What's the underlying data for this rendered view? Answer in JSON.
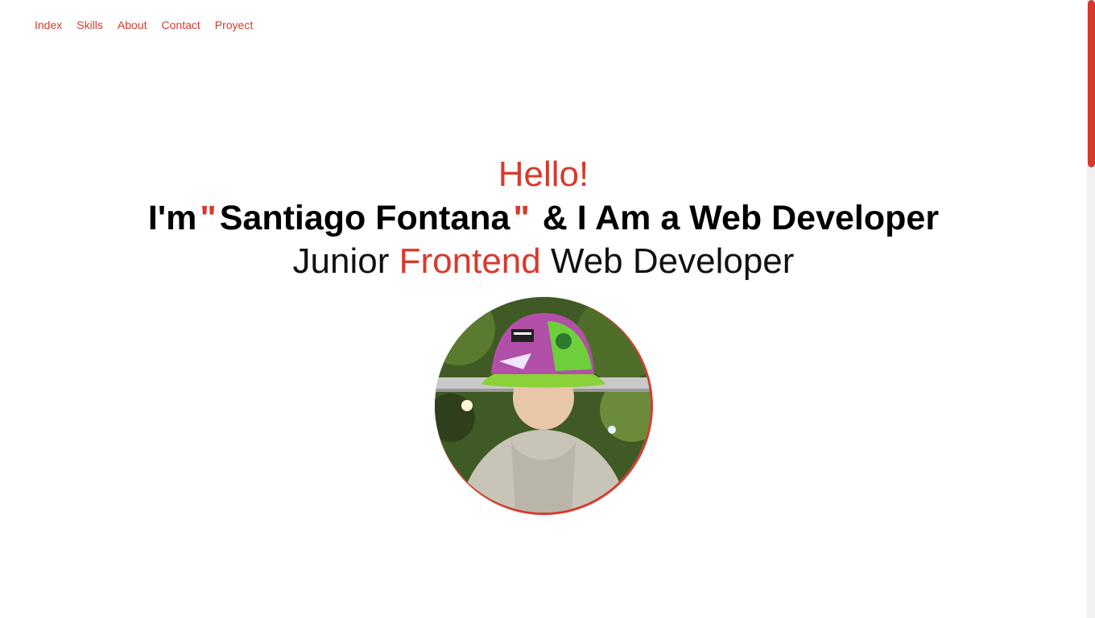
{
  "nav": {
    "items": [
      {
        "label": "Index"
      },
      {
        "label": "Skills"
      },
      {
        "label": "About"
      },
      {
        "label": "Contact"
      },
      {
        "label": "Proyect"
      }
    ]
  },
  "hero": {
    "greeting": "Hello!",
    "headline": {
      "prefix": "I'm",
      "open_quote": "\"",
      "name": "Santiago Fontana",
      "close_quote": "\"",
      "suffix": "& I Am a Web Developer"
    },
    "subline": {
      "part1": "Junior",
      "highlight": "Frontend",
      "part2": "Web Developer"
    }
  },
  "avatar": {
    "icon": "profile-photo"
  },
  "colors": {
    "accent": "#d63a2c",
    "text": "#000000",
    "background": "#ffffff"
  }
}
